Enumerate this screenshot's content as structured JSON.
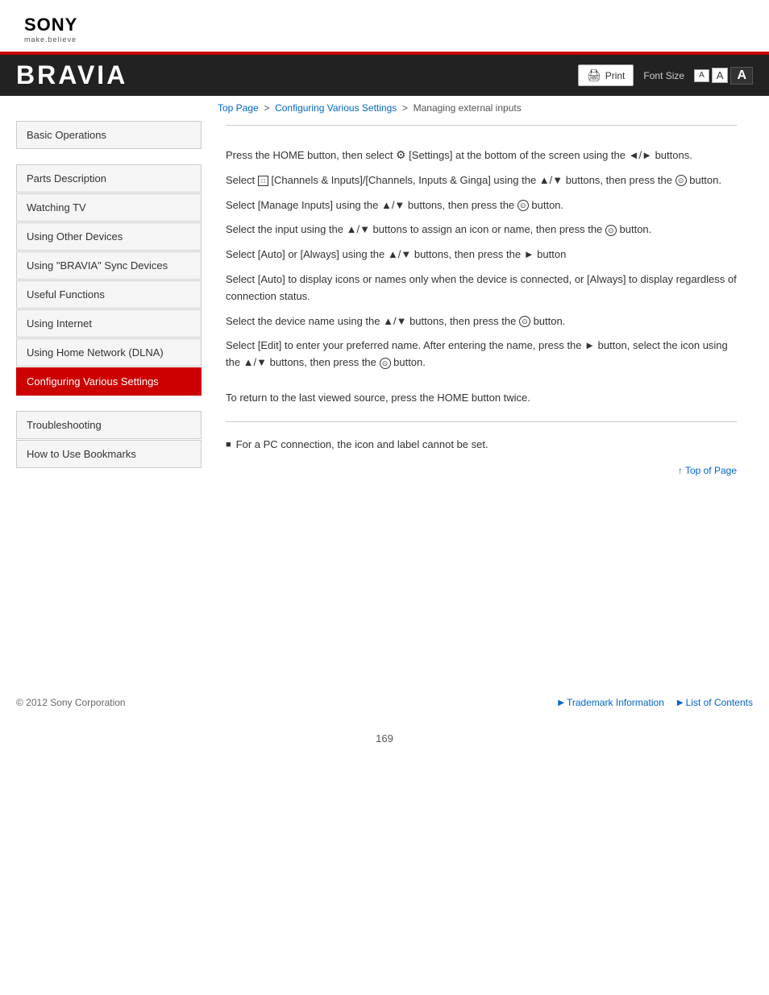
{
  "logo": {
    "company": "SONY",
    "tagline": "make.believe"
  },
  "banner": {
    "title": "BRAVIA",
    "print_label": "Print",
    "font_size_label": "Font Size",
    "font_small": "A",
    "font_medium": "A",
    "font_large": "A"
  },
  "breadcrumb": {
    "top": "Top Page",
    "section": "Configuring Various Settings",
    "current": "Managing external inputs"
  },
  "sidebar": {
    "items": [
      {
        "label": "Basic Operations",
        "active": false
      },
      {
        "label": "Parts Description",
        "active": false
      },
      {
        "label": "Watching TV",
        "active": false
      },
      {
        "label": "Using Other Devices",
        "active": false
      },
      {
        "label": "Using \"BRAVIA\" Sync Devices",
        "active": false
      },
      {
        "label": "Useful Functions",
        "active": false
      },
      {
        "label": "Using Internet",
        "active": false
      },
      {
        "label": "Using Home Network (DLNA)",
        "active": false
      },
      {
        "label": "Configuring Various Settings",
        "active": true
      },
      {
        "label": "Troubleshooting",
        "active": false
      },
      {
        "label": "How to Use Bookmarks",
        "active": false
      }
    ]
  },
  "main": {
    "steps": [
      "Press the HOME button, then select  [Settings] at the bottom of the screen using the ◄/► buttons.",
      "Select  [Channels & Inputs]/[Channels, Inputs & Ginga] using the ▲/▼ buttons, then press the ⊙ button.",
      "Select [Manage Inputs] using the ▲/▼ buttons, then press the ⊙ button.",
      "Select the input using the ▲/▼ buttons to assign an icon or name, then press the ⊙ button.",
      "Select [Auto] or [Always] using the ▲/▼ buttons, then press the ► button",
      "Select [Auto] to display icons or names only when the device is connected, or [Always] to display regardless of connection status.",
      "Select the device name using the ▲/▼ buttons, then press the ⊙ button.",
      "Select [Edit] to enter your preferred name. After entering the name, press the ► button, select the icon using the ▲/▼ buttons, then press the ⊙ button."
    ],
    "return_text": "To return to the last viewed source, press the HOME button twice.",
    "note": "For a PC connection, the icon and label cannot be set.",
    "top_of_page": "Top of Page"
  },
  "footer": {
    "copyright": "© 2012 Sony Corporation",
    "trademark": "Trademark Information",
    "list_of_contents": "List of Contents"
  },
  "page_number": "169"
}
